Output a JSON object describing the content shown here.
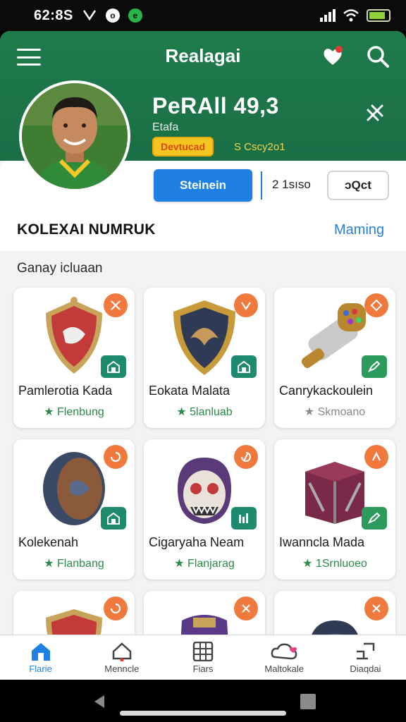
{
  "status_bar": {
    "time": "62:8S",
    "icons": [
      "signal-icon",
      "wifi-icon",
      "battery-icon"
    ]
  },
  "header": {
    "title": "Realagai",
    "player_name": "PeRAll 49,3",
    "player_sub": "Etafa",
    "rank_badge": "Devtucad",
    "rank_extra": "S Cscy2o1"
  },
  "profile": {
    "primary_button": "Steinein",
    "count": "2 1sıso",
    "outline_button": "ɔQct"
  },
  "collection": {
    "title": "KOLEXAI NUMRUK",
    "link": "Maming",
    "subtitle": "Ganay icluaan",
    "items": [
      {
        "name": "Pamlerotia Kada",
        "meta": "★ Flenbung",
        "muted": false
      },
      {
        "name": "Eokata Malata",
        "meta": "★ 5lanluab",
        "muted": false
      },
      {
        "name": "Canrykackoulein",
        "meta": "★ Skmoano",
        "muted": true
      },
      {
        "name": "Kolekenah",
        "meta": "★ Flanbang",
        "muted": false
      },
      {
        "name": "Cigaryaha Neam",
        "meta": "★ Flanjarag",
        "muted": false
      },
      {
        "name": "Iwanncla Mada",
        "meta": "★ 1Srnluoeo",
        "muted": false
      }
    ]
  },
  "bottom_nav": [
    {
      "label": "Flarie",
      "icon": "home-icon",
      "active": true
    },
    {
      "label": "Menncle",
      "icon": "bell-icon",
      "active": false
    },
    {
      "label": "Fiars",
      "icon": "grid-icon",
      "active": false
    },
    {
      "label": "Maltokale",
      "icon": "cloud-heart-icon",
      "active": false
    },
    {
      "label": "Diaqdai",
      "icon": "bracket-icon",
      "active": false
    }
  ],
  "colors": {
    "header_green": "#1f7b4c",
    "accent_blue": "#1f7fe3",
    "corner_orange": "#f07a3e",
    "tag_teal": "#1f8b6e"
  }
}
